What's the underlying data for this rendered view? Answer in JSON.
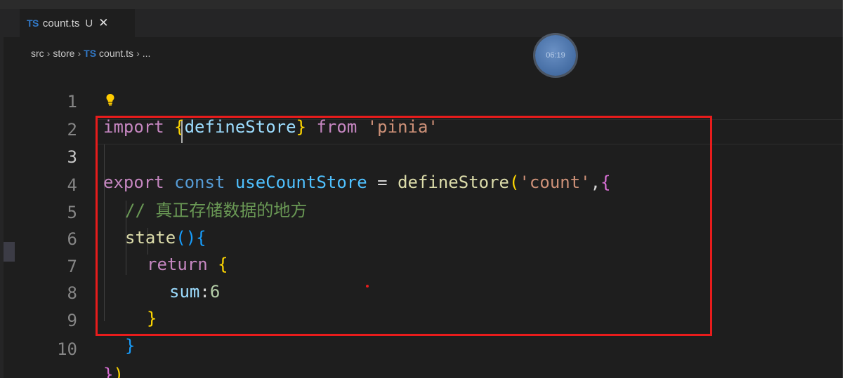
{
  "tab": {
    "badge": "TS",
    "file_name": "count.ts",
    "status": "U",
    "close": "✕"
  },
  "breadcrumb": [
    {
      "label": "src"
    },
    {
      "label": "store"
    },
    {
      "badge": "TS",
      "label": "count.ts"
    },
    {
      "label": "..."
    }
  ],
  "breadcrumb_sep": "›",
  "timer": "06:19",
  "line_numbers": [
    "1",
    "2",
    "3",
    "4",
    "5",
    "6",
    "7",
    "8",
    "9",
    "10"
  ],
  "code": {
    "l1": {
      "kw": "import",
      "open": "{",
      "name": "defineStore",
      "close": "}",
      "from": "from",
      "str": "'pinia'"
    },
    "l3": {
      "kw": "export",
      "const": "const",
      "var": "useCountStore",
      "eq": "=",
      "fn": "defineStore",
      "paren": "(",
      "str": "'count'",
      "comma": ",",
      "brace": "{"
    },
    "l4": {
      "comment": "// 真正存储数据的地方"
    },
    "l5": {
      "fn": "state",
      "parens": "()",
      "brace": "{"
    },
    "l6": {
      "kw": "return",
      "brace": "{"
    },
    "l7": {
      "prop": "sum",
      "colon": ":",
      "num": "6"
    },
    "l8": {
      "brace": "}"
    },
    "l9": {
      "brace": "}"
    },
    "l10": {
      "brace": "}",
      "paren": ")"
    }
  },
  "colors": {
    "highlight_box": "#e81c1c",
    "editor_bg": "#1e1e1e",
    "ts_badge": "#3178c6"
  },
  "icons": [
    "lightbulb-icon",
    "close-icon",
    "chevron-right-icon"
  ]
}
